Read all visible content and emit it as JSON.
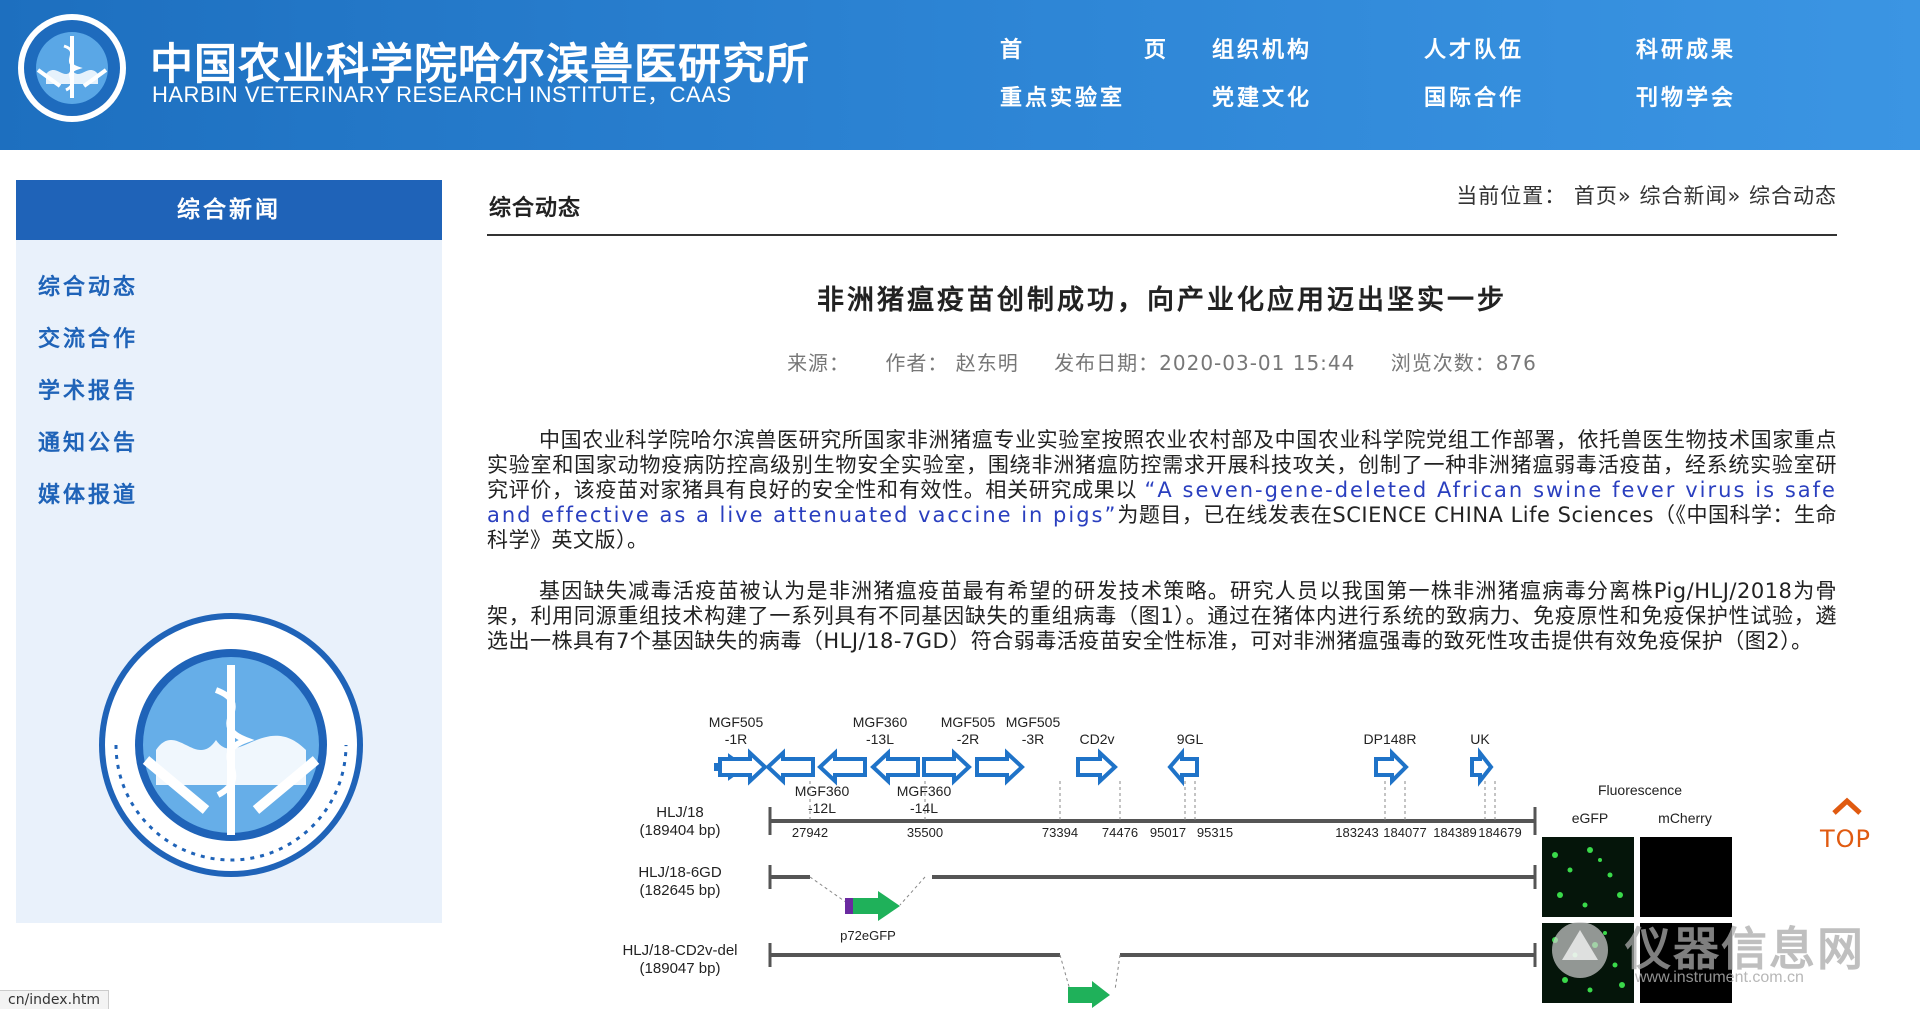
{
  "header": {
    "name_cn": "中国农业科学院哈尔滨兽医研究所",
    "name_en": "HARBIN VETERINARY RESEARCH INSTITUTE，CAAS",
    "nav": [
      "首　页",
      "组织机构",
      "人才队伍",
      "科研成果",
      "重点实验室",
      "党建文化",
      "国际合作",
      "刊物学会"
    ]
  },
  "sidebar": {
    "title": "综合新闻",
    "items": [
      "综合动态",
      "交流合作",
      "学术报告",
      "通知公告",
      "媒体报道"
    ]
  },
  "main": {
    "section": "综合动态",
    "breadcrumb": {
      "prefix": "当前位置：",
      "home": "首页",
      "sep1": "»",
      "news": "综合新闻",
      "sep2": "»",
      "current": "综合动态"
    },
    "title": "非洲猪瘟疫苗创制成功，向产业化应用迈出坚实一步",
    "meta": {
      "source": "来源：",
      "author": "作者：  赵东明",
      "date": "发布日期：2020-03-01 15:44",
      "views": "浏览次数：876"
    },
    "para1_a": "中国农业科学院哈尔滨兽医研究所国家非洲猪瘟专业实验室按照农业农村部及中国农业科学院党组工作部署，依托兽医生物技术国家重点实验室和国家动物疫病防控高级别生物安全实验室，围绕非洲猪瘟防控需求开展科技攻关，创制了一种非洲猪瘟弱毒活疫苗，经系统实验室研究评价，该疫苗对家猪具有良好的安全性和有效性。相关研究成果以 ",
    "para1_eng": "“A seven-gene-deleted African swine fever virus is safe and effective as a live attenuated vaccine in pigs”",
    "para1_b": "为题目，已在线发表在SCIENCE CHINA Life Sciences（《中国科学：生命科学》英文版）。",
    "para2": "基因缺失减毒活疫苗被认为是非洲猪瘟疫苗最有希望的研发技术策略。研究人员以我国第一株非洲猪瘟病毒分离株Pig/HLJ/2018为骨架，利用同源重组技术构建了一系列具有不同基因缺失的重组病毒（图1）。通过在猪体内进行系统的致病力、免疫原性和免疫保护性试验，遴选出一株具有7个基因缺失的病毒（HLJ/18-7GD）符合弱毒活疫苗安全性标准，可对非洲猪瘟强毒的致死性攻击提供有效免疫保护（图2）。"
  },
  "figure": {
    "genes_top": [
      "MGF505",
      "-1R",
      "MGF360",
      "-13L",
      "MGF505",
      "-2R",
      "MGF505",
      "-3R",
      "CD2v",
      "9GL",
      "DP148R",
      "UK"
    ],
    "genes_bottom": [
      "MGF360",
      "-12L",
      "MGF360",
      "-14L"
    ],
    "strains": [
      "HLJ/18",
      "(189404 bp)",
      "HLJ/18-6GD",
      "(182645 bp)",
      "HLJ/18-CD2v-del",
      "(189047 bp)"
    ],
    "positions": [
      "27942",
      "35500",
      "73394",
      "74476",
      "95017",
      "95315",
      "183243",
      "184077",
      "184389",
      "184679"
    ],
    "marker": "p72eGFP",
    "fluor_title": "Fluorescence",
    "fluor_cols": [
      "eGFP",
      "mCherry"
    ]
  },
  "top_button": "TOP",
  "status_url": "cn/index.htm",
  "watermark": {
    "cn": "仪器信息网",
    "en": "www.instrument.com.cn"
  }
}
